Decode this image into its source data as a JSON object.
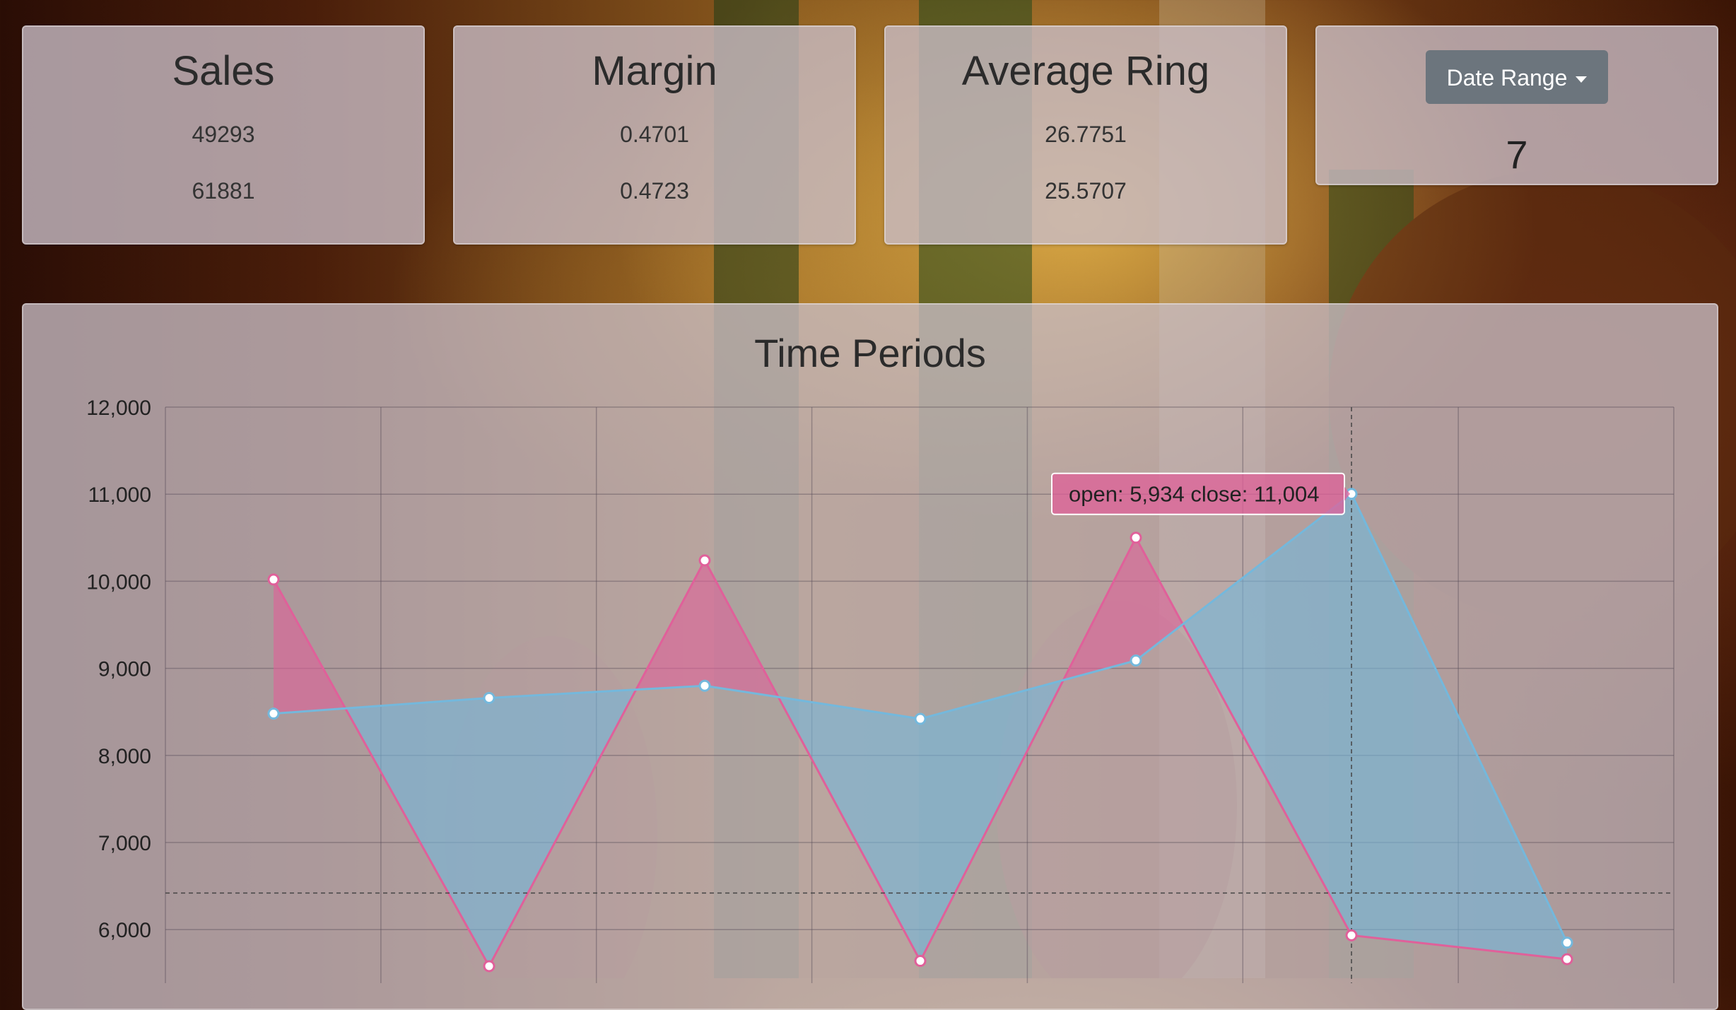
{
  "cards": [
    {
      "title": "Sales",
      "values": [
        "49293",
        "61881"
      ]
    },
    {
      "title": "Margin",
      "values": [
        "0.4701",
        "0.4723"
      ]
    },
    {
      "title": "Average Ring",
      "values": [
        "26.7751",
        "25.5707"
      ]
    }
  ],
  "date_range": {
    "button_label": "Date Range",
    "value": "7"
  },
  "colors": {
    "open_series": "#e0609a",
    "close_series": "#74b8dc",
    "button": "#6c757d"
  },
  "icons": {
    "dropdown": "caret-down-icon"
  },
  "chart_data": {
    "type": "area",
    "title": "Time Periods",
    "xlabel": "",
    "ylabel": "",
    "x": [
      1,
      2,
      3,
      4,
      5,
      6,
      7
    ],
    "ylim": [
      5500,
      12000
    ],
    "yticks": [
      6000,
      7000,
      8000,
      9000,
      10000,
      11000,
      12000
    ],
    "ytick_labels": [
      "6,000",
      "7,000",
      "8,000",
      "9,000",
      "10,000",
      "11,000",
      "12,000"
    ],
    "grid": true,
    "series": [
      {
        "name": "open",
        "values": [
          10020,
          5580,
          10240,
          5640,
          10500,
          5934,
          5660
        ]
      },
      {
        "name": "close",
        "values": [
          8480,
          8660,
          8800,
          8420,
          9090,
          11004,
          5850
        ]
      }
    ],
    "hover_index": 5,
    "hover_line_y": 6420,
    "tooltip": "open: 5,934 close: 11,004"
  }
}
